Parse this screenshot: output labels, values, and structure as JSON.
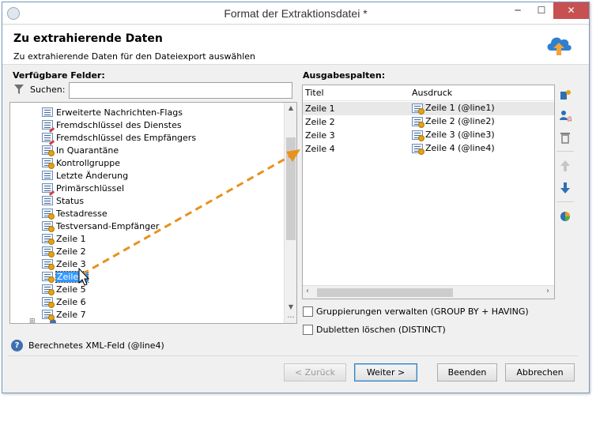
{
  "window": {
    "title": "Format der Extraktionsdatei *",
    "minimize": "─",
    "maximize": "☐",
    "close": "✕"
  },
  "header": {
    "title": "Zu extrahierende Daten",
    "subtitle": "Zu extrahierende Daten für den Dateiexport auswählen",
    "icon": "cloud-upload-icon"
  },
  "left": {
    "label": "Verfügbare Felder:",
    "search_label": "Suchen:",
    "search_value": "",
    "items": [
      {
        "label": "Erweiterte Nachrichten-Flags",
        "icon": "field-icon"
      },
      {
        "label": "Fremdschlüssel des Dienstes",
        "icon": "foreign-key-icon"
      },
      {
        "label": "Fremdschlüssel des Empfängers",
        "icon": "foreign-key-icon"
      },
      {
        "label": "In Quarantäne",
        "icon": "computed-field-icon"
      },
      {
        "label": "Kontrollgruppe",
        "icon": "computed-field-icon"
      },
      {
        "label": "Letzte Änderung",
        "icon": "field-icon"
      },
      {
        "label": "Primärschlüssel",
        "icon": "primary-key-icon"
      },
      {
        "label": "Status",
        "icon": "field-icon"
      },
      {
        "label": "Testadresse",
        "icon": "computed-field-icon"
      },
      {
        "label": "Testversand-Empfänger",
        "icon": "computed-field-icon"
      },
      {
        "label": "Zeile 1",
        "icon": "computed-field-icon"
      },
      {
        "label": "Zeile 2",
        "icon": "computed-field-icon"
      },
      {
        "label": "Zeile 3",
        "icon": "computed-field-icon"
      },
      {
        "label": "Zeile 4",
        "icon": "computed-field-icon"
      },
      {
        "label": "Zeile 5",
        "icon": "computed-field-icon"
      },
      {
        "label": "Zeile 6",
        "icon": "computed-field-icon"
      },
      {
        "label": "Zeile 7",
        "icon": "computed-field-icon"
      }
    ],
    "selected_index": 13
  },
  "right": {
    "label": "Ausgabespalten:",
    "columns": [
      "Titel",
      "Ausdruck"
    ],
    "rows": [
      {
        "title": "Zeile 1",
        "expression": "Zeile 1 (@line1)"
      },
      {
        "title": "Zeile 2",
        "expression": "Zeile 2 (@line2)"
      },
      {
        "title": "Zeile 3",
        "expression": "Zeile 3 (@line3)"
      },
      {
        "title": "Zeile 4",
        "expression": "Zeile 4 (@line4)"
      }
    ],
    "tools": [
      "add-column-icon",
      "add-expression-icon",
      "delete-icon",
      "move-up-icon",
      "move-down-icon",
      "distribution-icon"
    ]
  },
  "options": {
    "group_by": "Gruppierungen verwalten (GROUP BY + HAVING)",
    "distinct": "Dubletten löschen (DISTINCT)"
  },
  "footer": {
    "info": "Berechnetes XML-Feld (@line4)",
    "back": "< Zurück",
    "next": "Weiter >",
    "finish": "Beenden",
    "cancel": "Abbrechen"
  },
  "colors": {
    "drag_arrow": "#e8911c",
    "selection": "#3399ff",
    "close_button": "#c75050"
  }
}
